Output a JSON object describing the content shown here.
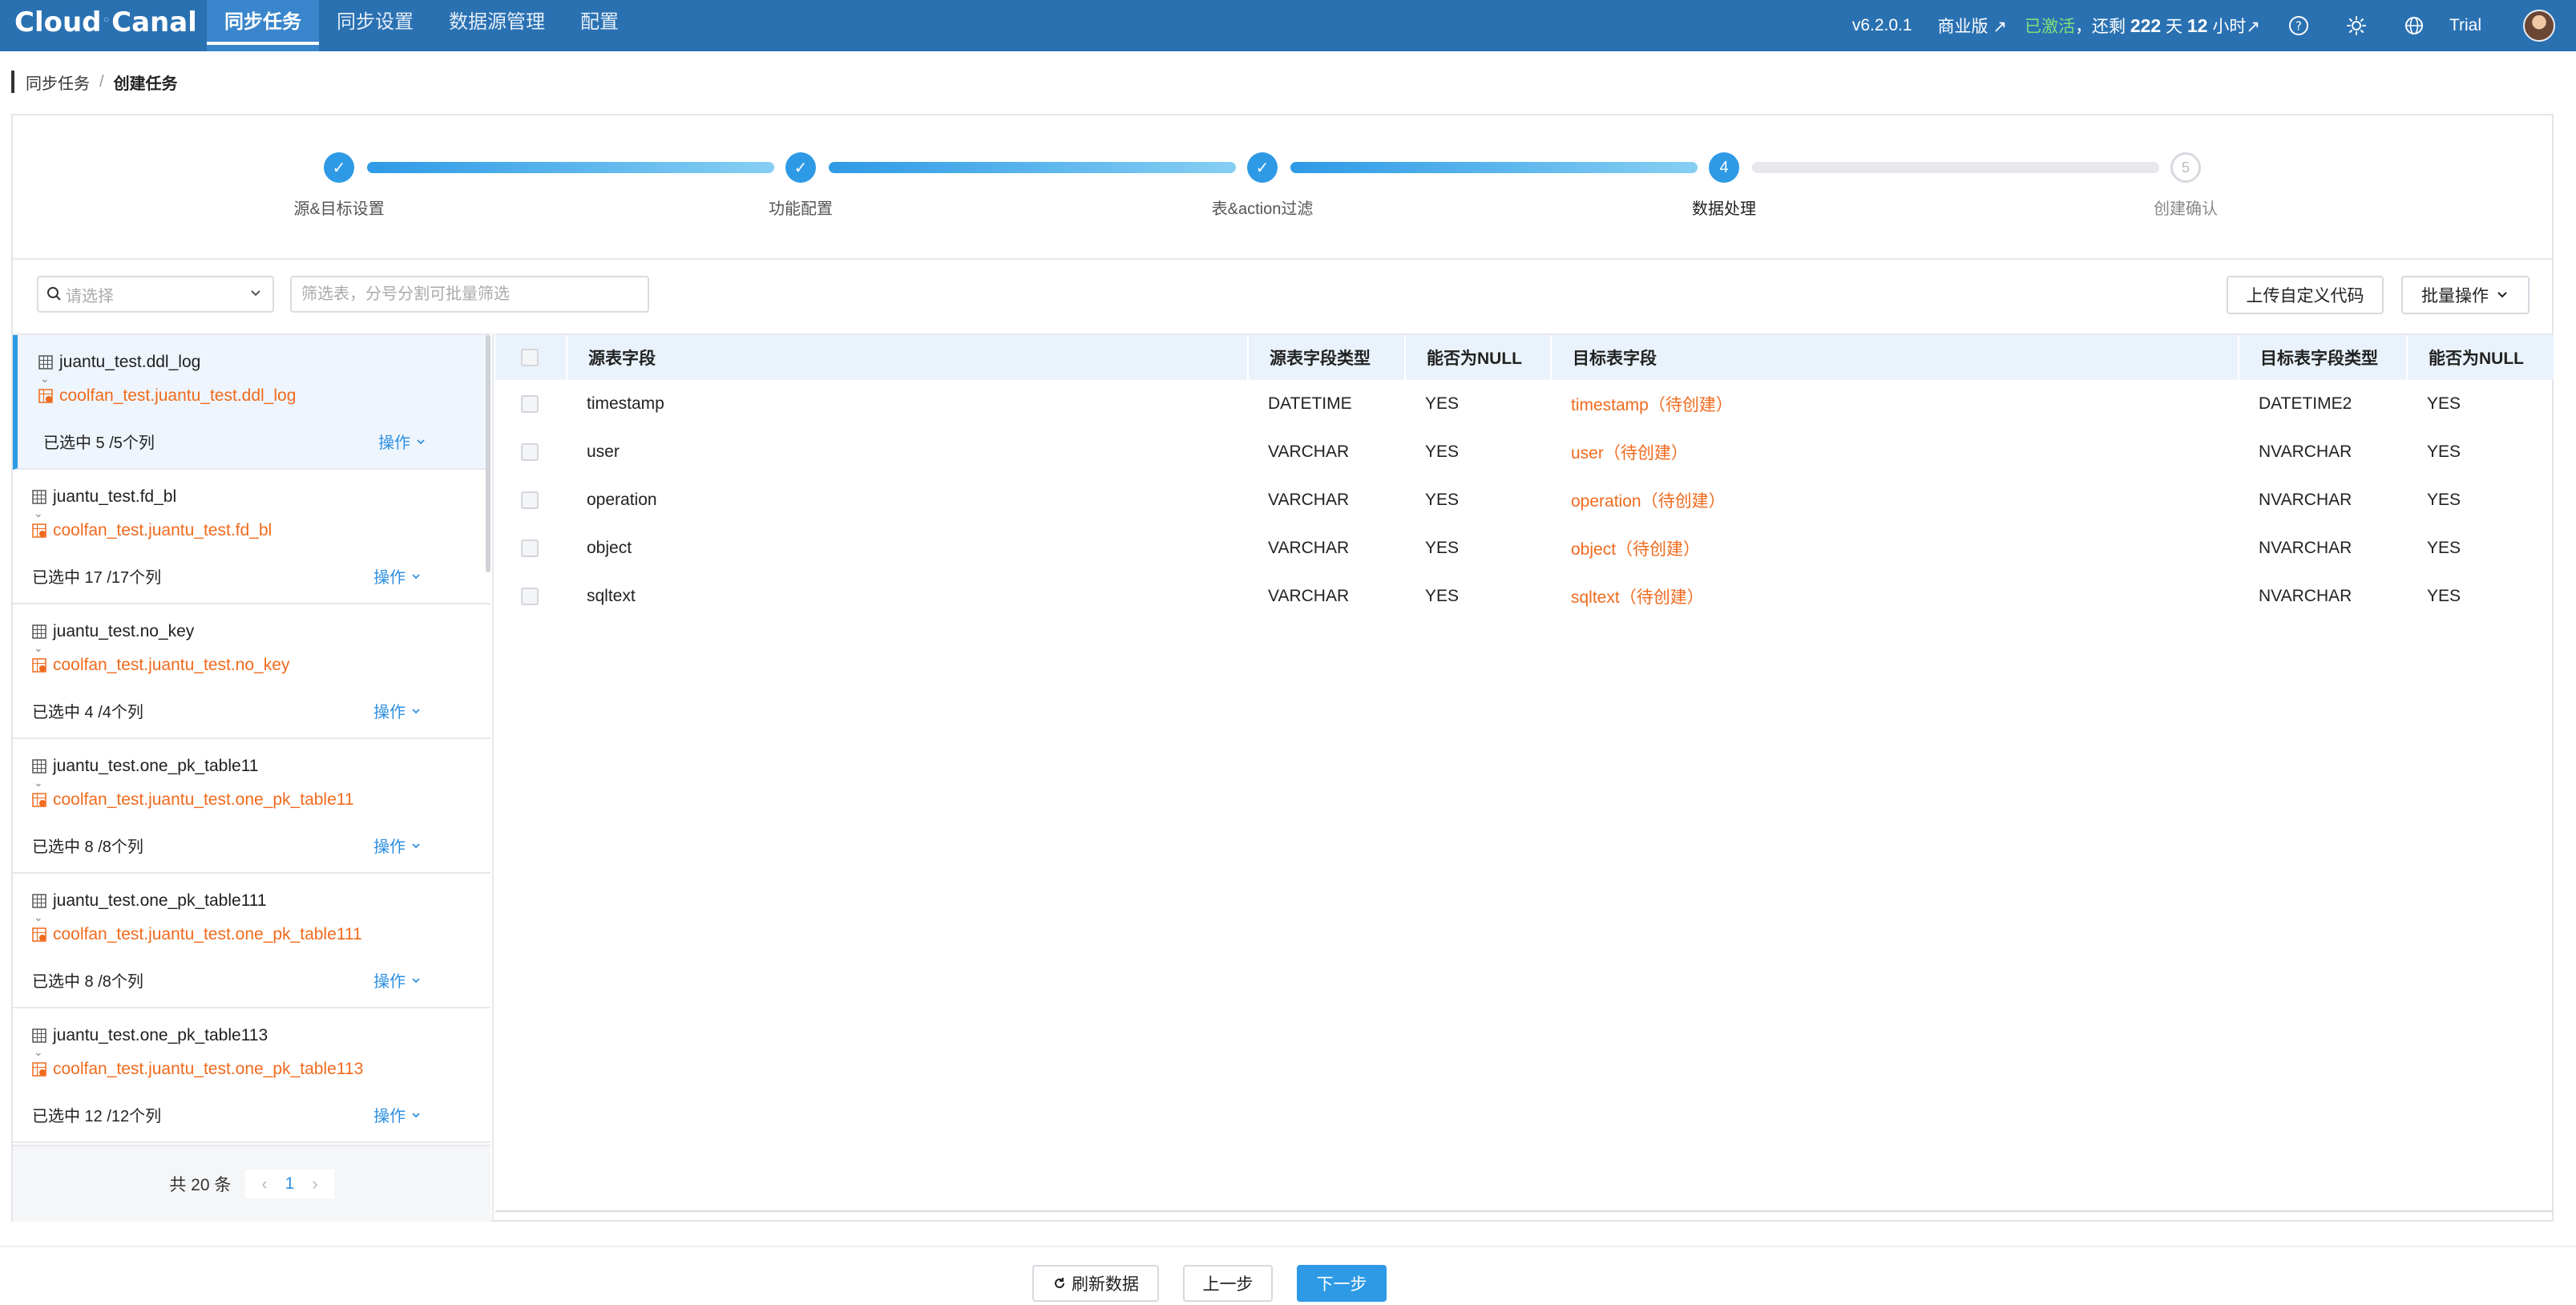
{
  "app": {
    "logo": "CloudCanal",
    "logo_left": "Cloud",
    "logo_right": "Canal"
  },
  "nav": {
    "items": [
      {
        "label": "同步任务",
        "active": true
      },
      {
        "label": "同步设置",
        "active": false
      },
      {
        "label": "数据源管理",
        "active": false
      },
      {
        "label": "配置",
        "active": false
      }
    ],
    "version": "v6.2.0.1",
    "edition": "商业版",
    "activated": "已激活",
    "remain_prefix": "，还剩",
    "remain_days": "222",
    "remain_day_unit": "天",
    "remain_hours": "12",
    "remain_hour_unit": "小时",
    "user": "Trial",
    "icons": [
      "help-icon",
      "theme-sun-icon",
      "language-globe-icon"
    ]
  },
  "breadcrumb": {
    "parent": "同步任务",
    "separator": "/",
    "current": "创建任务"
  },
  "steps": [
    {
      "label": "源&目标设置",
      "status": "done",
      "marker": "✓"
    },
    {
      "label": "功能配置",
      "status": "done",
      "marker": "✓"
    },
    {
      "label": "表&action过滤",
      "status": "done",
      "marker": "✓"
    },
    {
      "label": "数据处理",
      "status": "current",
      "marker": "4"
    },
    {
      "label": "创建确认",
      "status": "todo",
      "marker": "5"
    }
  ],
  "toolbar": {
    "select_placeholder": "请选择",
    "filter_placeholder": "筛选表，分号分割可批量筛选",
    "upload_label": "上传自定义代码",
    "batch_label": "批量操作"
  },
  "tables": [
    {
      "source": "juantu_test.ddl_log",
      "target": "coolfan_test.juantu_test.ddl_log",
      "selected": "已选中 5 /5个列",
      "op": "操作"
    },
    {
      "source": "juantu_test.fd_bl",
      "target": "coolfan_test.juantu_test.fd_bl",
      "selected": "已选中 17 /17个列",
      "op": "操作"
    },
    {
      "source": "juantu_test.no_key",
      "target": "coolfan_test.juantu_test.no_key",
      "selected": "已选中 4 /4个列",
      "op": "操作"
    },
    {
      "source": "juantu_test.one_pk_table11",
      "target": "coolfan_test.juantu_test.one_pk_table11",
      "selected": "已选中 8 /8个列",
      "op": "操作"
    },
    {
      "source": "juantu_test.one_pk_table111",
      "target": "coolfan_test.juantu_test.one_pk_table111",
      "selected": "已选中 8 /8个列",
      "op": "操作"
    },
    {
      "source": "juantu_test.one_pk_table113",
      "target": "coolfan_test.juantu_test.one_pk_table113",
      "selected": "已选中 12 /12个列",
      "op": "操作"
    }
  ],
  "pagination": {
    "total": "共 20 条",
    "prev": "‹",
    "page": "1",
    "next": "›"
  },
  "grid": {
    "columns": [
      "源表字段",
      "源表字段类型",
      "能否为NULL",
      "目标表字段",
      "目标表字段类型",
      "能否为NULL"
    ],
    "rows": [
      [
        "timestamp",
        "DATETIME",
        "YES",
        "timestamp（待创建）",
        "DATETIME2",
        "YES"
      ],
      [
        "user",
        "VARCHAR",
        "YES",
        "user（待创建）",
        "NVARCHAR",
        "YES"
      ],
      [
        "operation",
        "VARCHAR",
        "YES",
        "operation（待创建）",
        "NVARCHAR",
        "YES"
      ],
      [
        "object",
        "VARCHAR",
        "YES",
        "object（待创建）",
        "NVARCHAR",
        "YES"
      ],
      [
        "sqltext",
        "VARCHAR",
        "YES",
        "sqltext（待创建）",
        "NVARCHAR",
        "YES"
      ]
    ]
  },
  "footer": {
    "refresh": "刷新数据",
    "prev": "上一步",
    "next": "下一步"
  },
  "colors": {
    "nav_bg": "#2a71b2",
    "accent": "#2e9ae6",
    "pending_field": "#f06a1d",
    "activated": "#7ee07a"
  }
}
